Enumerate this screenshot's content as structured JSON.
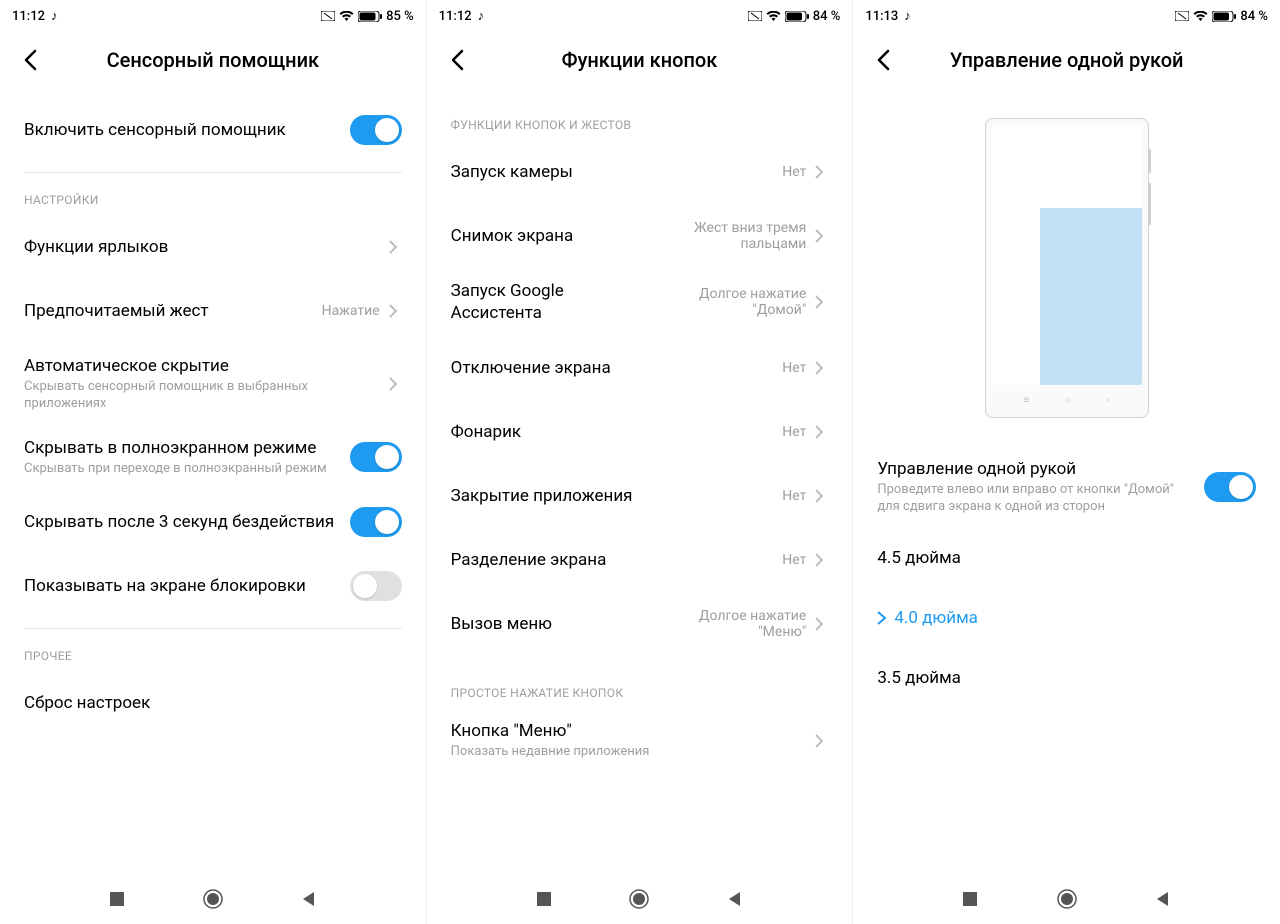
{
  "screens": [
    {
      "status": {
        "time": "11:12",
        "battery": "85 %"
      },
      "title": "Сенсорный помощник",
      "enable": {
        "label": "Включить сенсорный помощник",
        "on": true
      },
      "section_settings": "НАСТРОЙКИ",
      "shortcut": {
        "label": "Функции ярлыков"
      },
      "gesture": {
        "label": "Предпочитаемый жест",
        "value": "Нажатие"
      },
      "autohide": {
        "label": "Автоматическое скрытие",
        "sub": "Скрывать сенсорный помощник в выбранных приложениях"
      },
      "fullscreen": {
        "label": "Скрывать в полноэкранном режиме",
        "sub": "Скрывать при переходе в полноэкранный режим",
        "on": true
      },
      "idle": {
        "label": "Скрывать после 3 секунд бездействия",
        "on": true
      },
      "lock": {
        "label": "Показывать на экране блокировки",
        "on": false
      },
      "section_other": "ПРОЧЕЕ",
      "reset": {
        "label": "Сброс настроек"
      }
    },
    {
      "status": {
        "time": "11:12",
        "battery": "84 %"
      },
      "title": "Функции кнопок",
      "section_gestures": "ФУНКЦИИ КНОПОК И ЖЕСТОВ",
      "items": [
        {
          "label": "Запуск камеры",
          "value": "Нет"
        },
        {
          "label": "Снимок экрана",
          "value": "Жест вниз тремя пальцами"
        },
        {
          "label": "Запуск Google Ассистента",
          "value": "Долгое нажатие \"Домой\""
        },
        {
          "label": "Отключение экрана",
          "value": "Нет"
        },
        {
          "label": "Фонарик",
          "value": "Нет"
        },
        {
          "label": "Закрытие приложения",
          "value": "Нет"
        },
        {
          "label": "Разделение экрана",
          "value": "Нет"
        },
        {
          "label": "Вызов меню",
          "value": "Долгое нажатие \"Меню\""
        }
      ],
      "section_press": "ПРОСТОЕ НАЖАТИЕ КНОПОК",
      "menubtn": {
        "label": "Кнопка \"Меню\"",
        "sub": "Показать недавние приложения"
      }
    },
    {
      "status": {
        "time": "11:13",
        "battery": "84 %"
      },
      "title": "Управление одной рукой",
      "enable": {
        "label": "Управление одной рукой",
        "sub": "Проведите влево или вправо от кнопки \"Домой\" для сдвига экрана к одной из сторон",
        "on": true
      },
      "sizes": [
        "4.5 дюйма",
        "4.0 дюйма",
        "3.5 дюйма"
      ],
      "selected_index": 1
    }
  ]
}
